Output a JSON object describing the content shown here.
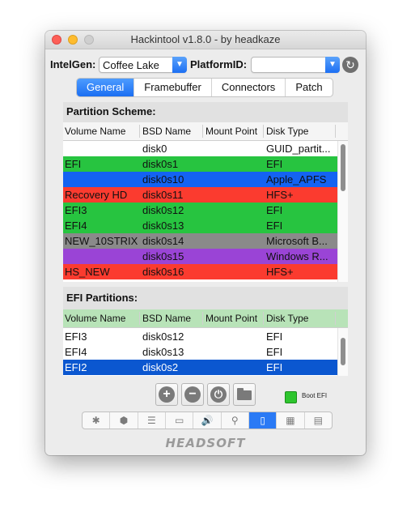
{
  "window": {
    "title": "Hackintool v1.8.0 - by headkaze"
  },
  "top": {
    "intelgen_label": "IntelGen:",
    "intelgen_value": "Coffee Lake",
    "platform_label": "PlatformID:",
    "platform_value": ""
  },
  "tabs": [
    "General",
    "Framebuffer",
    "Connectors",
    "Patch"
  ],
  "partition": {
    "title": "Partition Scheme:",
    "columns": [
      "Volume Name",
      "BSD Name",
      "Mount Point",
      "Disk Type"
    ],
    "rows": [
      {
        "volume": "",
        "bsd": "disk0",
        "mount": "",
        "type": "GUID_partit...",
        "color": "#ffffff",
        "text": "#111111"
      },
      {
        "volume": "EFI",
        "bsd": "disk0s1",
        "mount": "",
        "type": "EFI",
        "color": "#27c440",
        "text": "#111111"
      },
      {
        "volume": "",
        "bsd": "disk0s10",
        "mount": "",
        "type": "Apple_APFS",
        "color": "#1463f2",
        "text": "#111111"
      },
      {
        "volume": "Recovery HD",
        "bsd": "disk0s11",
        "mount": "",
        "type": "HFS+",
        "color": "#fb3b2f",
        "text": "#111111"
      },
      {
        "volume": "EFI3",
        "bsd": "disk0s12",
        "mount": "",
        "type": "EFI",
        "color": "#27c440",
        "text": "#111111"
      },
      {
        "volume": "EFI4",
        "bsd": "disk0s13",
        "mount": "",
        "type": "EFI",
        "color": "#27c440",
        "text": "#111111"
      },
      {
        "volume": "NEW_10STRIX",
        "bsd": "disk0s14",
        "mount": "",
        "type": "Microsoft B...",
        "color": "#8a8a8a",
        "text": "#111111"
      },
      {
        "volume": "",
        "bsd": "disk0s15",
        "mount": "",
        "type": "Windows R...",
        "color": "#9a44d6",
        "text": "#111111"
      },
      {
        "volume": "HS_NEW",
        "bsd": "disk0s16",
        "mount": "",
        "type": "HFS+",
        "color": "#fb3b2f",
        "text": "#111111"
      }
    ]
  },
  "efi": {
    "title": "EFI Partitions:",
    "columns": [
      "Volume Name",
      "BSD Name",
      "Mount Point",
      "Disk Type"
    ],
    "header_color": "#b8e3b8",
    "rows": [
      {
        "volume": "EFI3",
        "bsd": "disk0s12",
        "mount": "",
        "type": "EFI",
        "color": "#ffffff",
        "text": "#111111"
      },
      {
        "volume": "EFI4",
        "bsd": "disk0s13",
        "mount": "",
        "type": "EFI",
        "color": "#ffffff",
        "text": "#111111"
      },
      {
        "volume": "EFI2",
        "bsd": "disk0s2",
        "mount": "",
        "type": "EFI",
        "color": "#0b57d0",
        "text": "#ffffff"
      }
    ]
  },
  "actions": {
    "add_glyph": "+",
    "remove_glyph": "−",
    "mount_glyph": "⏻",
    "boot_label": "Boot EFI"
  },
  "toolbar": [
    {
      "icon": "gear-icon",
      "glyph": "✱"
    },
    {
      "icon": "box-icon",
      "glyph": "⬢"
    },
    {
      "icon": "database-icon",
      "glyph": "☰"
    },
    {
      "icon": "display-icon",
      "glyph": "▭"
    },
    {
      "icon": "speaker-icon",
      "glyph": "🔊"
    },
    {
      "icon": "usb-icon",
      "glyph": "⚲"
    },
    {
      "icon": "disk-icon",
      "glyph": "▯",
      "active": true
    },
    {
      "icon": "calculator-icon",
      "glyph": "▦"
    },
    {
      "icon": "grid-icon",
      "glyph": "▤"
    }
  ],
  "brand": "HEADSOFT"
}
